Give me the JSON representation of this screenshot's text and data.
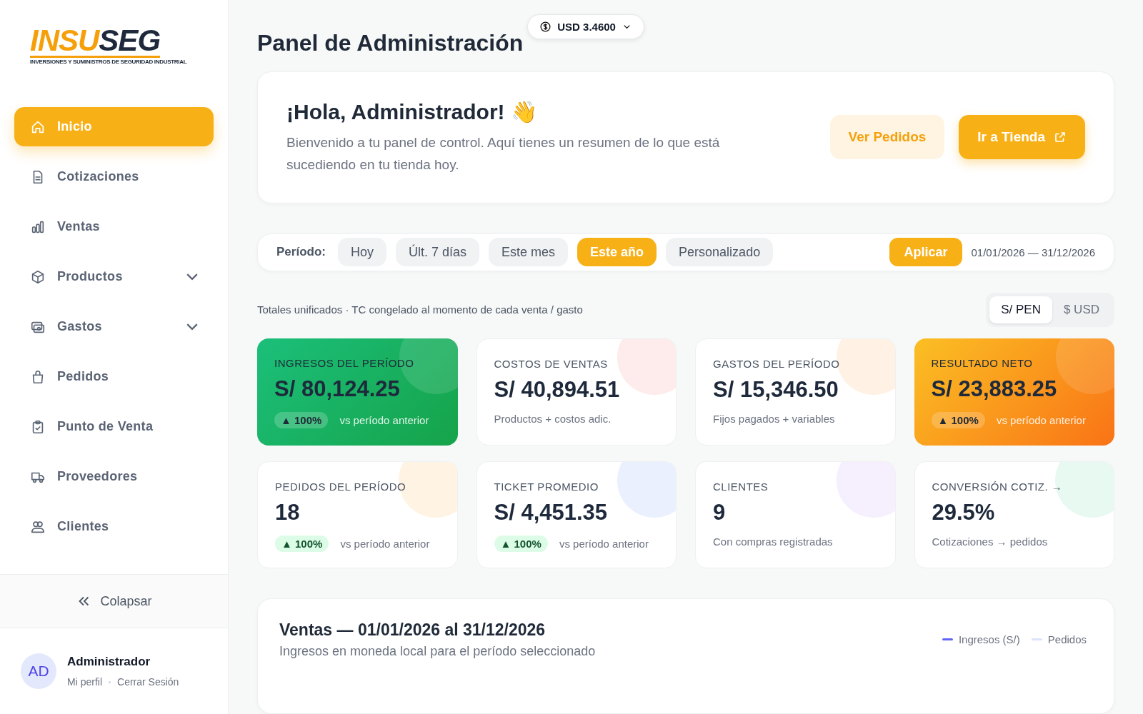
{
  "logo": {
    "accent": "INSU",
    "rest": "SEG",
    "tagline": "INVERSIONES Y SUMINISTROS DE SEGURIDAD INDUSTRIAL"
  },
  "sidebar": {
    "items": [
      {
        "label": "Inicio",
        "selected": true
      },
      {
        "label": "Cotizaciones",
        "selected": false
      },
      {
        "label": "Ventas",
        "selected": false
      },
      {
        "label": "Productos",
        "selected": false,
        "expanded": false
      },
      {
        "label": "Gastos",
        "selected": false,
        "expanded": false
      },
      {
        "label": "Pedidos",
        "selected": false
      },
      {
        "label": "Punto de Venta",
        "selected": false
      },
      {
        "label": "Proveedores",
        "selected": false
      },
      {
        "label": "Clientes",
        "selected": false
      }
    ],
    "collapse": "Colapsar",
    "user": {
      "initials": "AD",
      "name": "Administrador",
      "links": [
        "Mi perfil",
        "Cerrar Sesión"
      ]
    }
  },
  "header": {
    "title": "Panel de Administración",
    "rate": "USD 3.4600"
  },
  "welcome": {
    "title": "¡Hola, Administrador! 👋",
    "text": "Bienvenido a tu panel de control. Aquí tienes un resumen de lo que está sucediendo en tu tienda hoy.",
    "buttons": [
      {
        "label": "Ver Pedidos",
        "kind": "soft"
      },
      {
        "label": "Ir a Tienda",
        "kind": "primary"
      }
    ]
  },
  "period": {
    "label": "Período:",
    "options": [
      {
        "label": "Hoy",
        "selected": false
      },
      {
        "label": "Últ. 7 días",
        "selected": false
      },
      {
        "label": "Este mes",
        "selected": false
      },
      {
        "label": "Este año",
        "selected": true
      },
      {
        "label": "Personalizado",
        "selected": false
      }
    ],
    "apply": "Aplicar",
    "range": "01/01/2026 — 31/12/2026"
  },
  "totals_note": "Totales unificados · TC congelado al momento de cada venta / gasto",
  "currency": [
    {
      "label": "S/ PEN",
      "selected": true
    },
    {
      "label": "$ USD",
      "selected": false
    }
  ],
  "stats": [
    {
      "kind": "green",
      "label": "INGRESOS DEL PERÍODO",
      "value": "S/ 80,124.25",
      "badge": "▲ 100%",
      "note": "vs período anterior"
    },
    {
      "kind": "plain",
      "color": "#fdeceb",
      "label": "COSTOS DE VENTAS",
      "value": "S/ 40,894.51",
      "note": "Productos + costos adic."
    },
    {
      "kind": "plain",
      "color": "#fff1e3",
      "label": "GASTOS DEL PERÍODO",
      "value": "S/ 15,346.50",
      "note": "Fijos pagados + variables"
    },
    {
      "kind": "orange",
      "label": "RESULTADO NETO",
      "value": "S/ 23,883.25",
      "badge": "▲ 100%",
      "note": "vs período anterior"
    },
    {
      "kind": "plain",
      "color": "#fff3e3",
      "label": "PEDIDOS DEL PERÍODO",
      "value": "18",
      "badge": "▲ 100%",
      "note": "vs período anterior"
    },
    {
      "kind": "plain",
      "color": "#eaf0fe",
      "label": "TICKET PROMEDIO",
      "value": "S/ 4,451.35",
      "badge": "▲ 100%",
      "note": "vs período anterior"
    },
    {
      "kind": "plain",
      "color": "#f5effe",
      "label": "CLIENTES",
      "value": "9",
      "note": "Con compras registradas"
    },
    {
      "kind": "plain",
      "color": "#e8f9f1",
      "label": "CONVERSIÓN COTIZ. →",
      "value": "29.5%",
      "note": "Cotizaciones → pedidos"
    }
  ],
  "sales": {
    "title": "Ventas — 01/01/2026 al 31/12/2026",
    "subtitle": "Ingresos en moneda local para el período seleccionado",
    "legend": [
      {
        "label": "Ingresos (S/)",
        "color": "#6366f1"
      },
      {
        "label": "Pedidos",
        "color": "#dbe4fb"
      }
    ]
  }
}
